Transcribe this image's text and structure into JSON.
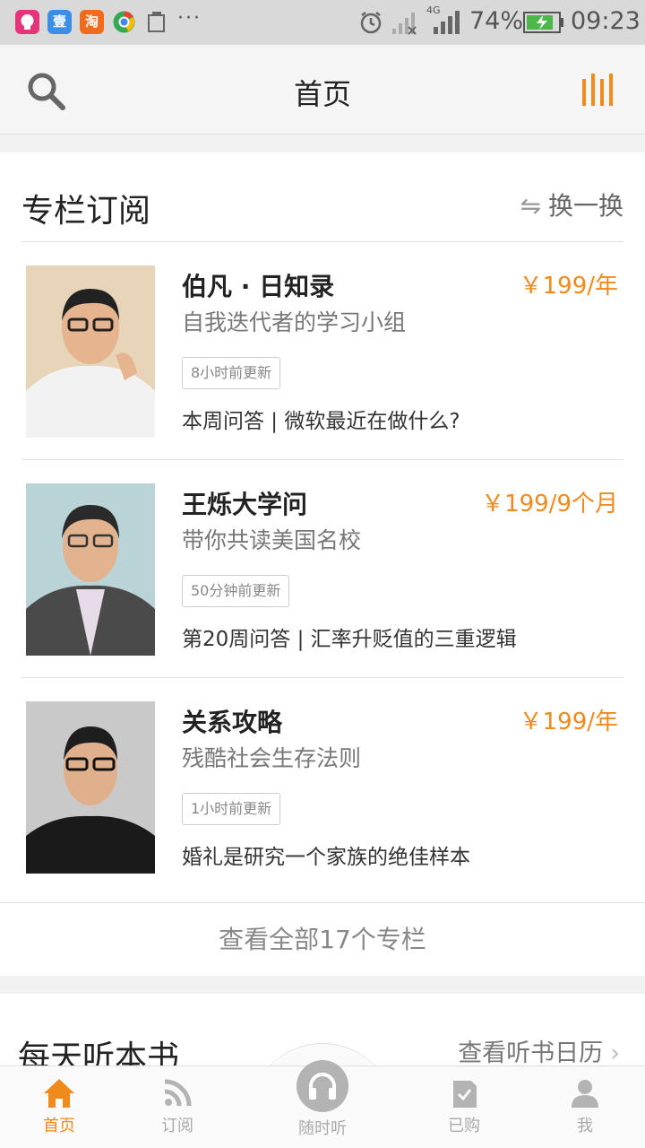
{
  "status_bar": {
    "time": "09:23",
    "battery": "74%",
    "network": "4G",
    "apps": [
      "壹",
      "淘"
    ],
    "more": "···"
  },
  "header": {
    "title": "首页"
  },
  "column_section": {
    "title": "专栏订阅",
    "refresh_label": "换一换",
    "items": [
      {
        "name": "伯凡 · 日知录",
        "price": "￥199/年",
        "subtitle": "自我迭代者的学习小组",
        "badge": "8小时前更新",
        "latest": "本周问答 | 微软最近在做什么?"
      },
      {
        "name": "王烁大学问",
        "price": "￥199/9个月",
        "subtitle": "带你共读美国名校",
        "badge": "50分钟前更新",
        "latest": "第20周问答 | 汇率升贬值的三重逻辑"
      },
      {
        "name": "关系攻略",
        "price": "￥199/年",
        "subtitle": "残酷社会生存法则",
        "badge": "1小时前更新",
        "latest": "婚礼是研究一个家族的绝佳样本"
      }
    ],
    "view_all": "查看全部17个专栏"
  },
  "book_section": {
    "title": "每天听本书",
    "link": "查看听书日历"
  },
  "bottom_nav": {
    "home": "首页",
    "subscribe": "订阅",
    "listen": "随时听",
    "purchased": "已购",
    "me": "我"
  },
  "colors": {
    "accent": "#f08a1c",
    "statusbar_bg": "#d9d9d9"
  }
}
